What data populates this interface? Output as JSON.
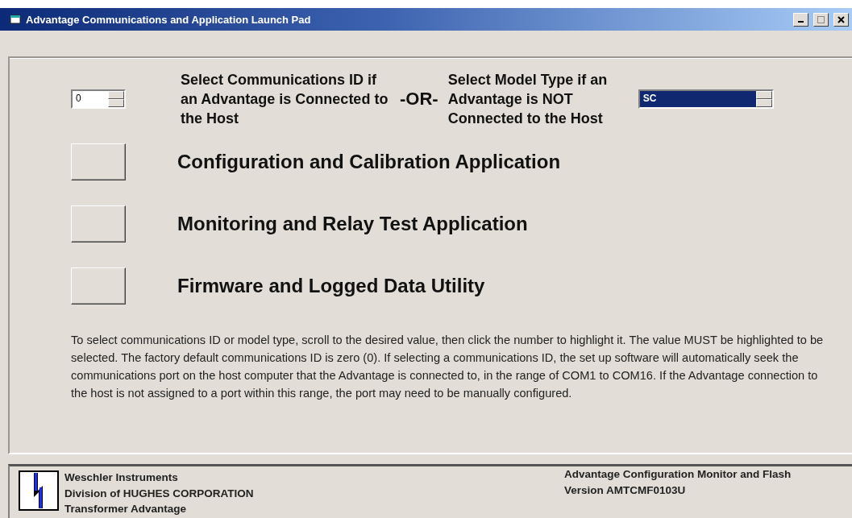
{
  "window": {
    "title": "Advantage Communications and Application Launch Pad"
  },
  "selectors": {
    "comm_id": {
      "value": "0",
      "selected": false
    },
    "comm_label": "Select Communications ID if an Advantage is Connected to the Host",
    "or_label": "-OR-",
    "model_label": "Select Model Type if an Advantage is NOT Connected to the Host",
    "model_type": {
      "value": "SC",
      "selected": true
    }
  },
  "applications": [
    {
      "label": "Configuration and Calibration Application"
    },
    {
      "label": "Monitoring and Relay Test Application"
    },
    {
      "label": "Firmware and Logged Data Utility"
    }
  ],
  "instructions": "To select communications ID or model type, scroll to the desired value, then click the number to highlight it. The value MUST be highlighted to be selected. The factory default communications ID is zero (0). If selecting a communications ID, the set up software will automatically seek the communications port on the host computer that the Advantage is connected to, in the range of COM1 to COM16. If the Advantage connection to the host is not assigned to a port within this range, the port may need to be manually configured.",
  "footer": {
    "left": [
      "Weschler Instruments",
      "Division of HUGHES CORPORATION",
      "Transformer Advantage"
    ],
    "right": [
      "Advantage Configuration Monitor and Flash",
      "Version AMTCMF0103U"
    ]
  }
}
